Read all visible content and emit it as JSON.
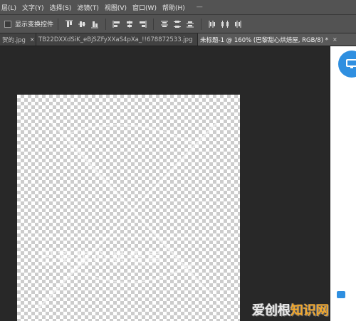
{
  "menu": {
    "items": [
      "层(L)",
      "文字(Y)",
      "选择(S)",
      "滤镜(T)",
      "视图(V)",
      "窗口(W)",
      "帮助(H)"
    ],
    "trail": "—"
  },
  "options": {
    "checkbox_label": "显示变换控件",
    "checked": false
  },
  "tabs": [
    {
      "label": "贺的.jpg",
      "close": "×",
      "active": false
    },
    {
      "label": "TB22DXXdSiK_eBjSZFyXXaS4pXa_!!678872533.jpg",
      "close": "×",
      "active": false
    },
    {
      "label": "未标题-1 @ 160% (巴黎甜心烘焙屋, RGB/8) *",
      "close": "×",
      "active": true
    }
  ],
  "canvas": {
    "faint_text": "巴黎甜心烘焙屋"
  },
  "watermark": {
    "part1": "爱创根",
    "part2": "知识网"
  },
  "colors": {
    "ui_bg": "#535353",
    "workspace": "#282828",
    "accent_blue": "#2f8fe0"
  }
}
